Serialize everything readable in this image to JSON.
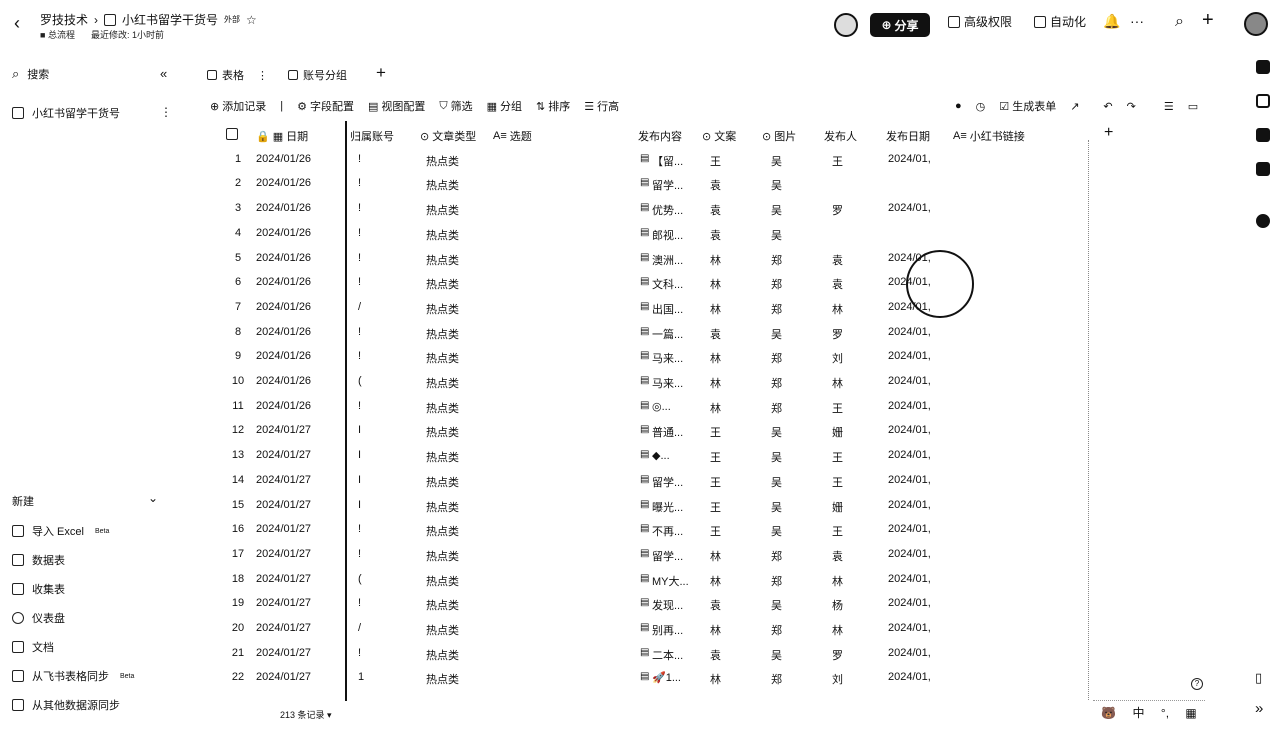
{
  "header": {
    "workspace": "罗技技术",
    "doc_title": "小红书留学干货号",
    "doc_tag": "外部",
    "folder": "总流程",
    "last_edited": "最近修改: 1小时前",
    "share_label": "分享",
    "advanced_perm": "高级权限",
    "automation": "自动化",
    "more": "···"
  },
  "sidebar": {
    "search_placeholder": "搜索",
    "table_name": "小红书留学干货号",
    "new_label": "新建",
    "items": [
      {
        "label": "导入 Excel",
        "beta": "Beta",
        "icon": "excel-icon"
      },
      {
        "label": "数据表",
        "beta": "",
        "icon": "table-icon"
      },
      {
        "label": "收集表",
        "beta": "",
        "icon": "form-icon"
      },
      {
        "label": "仪表盘",
        "beta": "",
        "icon": "dashboard-icon"
      },
      {
        "label": "文档",
        "beta": "",
        "icon": "doc-icon"
      },
      {
        "label": "从飞书表格同步",
        "beta": "Beta",
        "icon": "sync-icon"
      },
      {
        "label": "从其他数据源同步",
        "beta": "",
        "icon": "datasource-icon"
      }
    ]
  },
  "tabs": [
    {
      "label": "表格",
      "icon": "grid-icon"
    },
    {
      "label": "账号分组",
      "icon": "grid-icon"
    }
  ],
  "toolbar": {
    "add_record": "添加记录",
    "field_config": "字段配置",
    "view_config": "视图配置",
    "filter": "筛选",
    "group": "分组",
    "sort": "排序",
    "row_height": "行高",
    "generate_form": "生成表单"
  },
  "columns": [
    "日期",
    "归属账号",
    "文章类型",
    "选题",
    "发布内容",
    "文案",
    "图片",
    "发布人",
    "发布日期",
    "小红书链接"
  ],
  "rows": [
    {
      "n": "1",
      "date": "2024/01/26",
      "acct": "!",
      "type": "热点类",
      "content": "【留...",
      "copy": "王",
      "img": "吴",
      "pub": "王",
      "pdate": "2024/01,"
    },
    {
      "n": "2",
      "date": "2024/01/26",
      "acct": "!",
      "type": "热点类",
      "content": "留学...",
      "copy": "袁",
      "img": "吴",
      "pub": "",
      "pdate": ""
    },
    {
      "n": "3",
      "date": "2024/01/26",
      "acct": "!",
      "type": "热点类",
      "content": "优势...",
      "copy": "袁",
      "img": "吴",
      "pub": "罗",
      "pdate": "2024/01,"
    },
    {
      "n": "4",
      "date": "2024/01/26",
      "acct": "!",
      "type": "热点类",
      "content": "郎视...",
      "copy": "袁",
      "img": "吴",
      "pub": "",
      "pdate": ""
    },
    {
      "n": "5",
      "date": "2024/01/26",
      "acct": "!",
      "type": "热点类",
      "content": "澳洲...",
      "copy": "林",
      "img": "郑",
      "pub": "袁",
      "pdate": "2024/01,"
    },
    {
      "n": "6",
      "date": "2024/01/26",
      "acct": "!",
      "type": "热点类",
      "content": "文科...",
      "copy": "林",
      "img": "郑",
      "pub": "袁",
      "pdate": "2024/01,"
    },
    {
      "n": "7",
      "date": "2024/01/26",
      "acct": "/",
      "type": "热点类",
      "content": "出国...",
      "copy": "林",
      "img": "郑",
      "pub": "林",
      "pdate": "2024/01,"
    },
    {
      "n": "8",
      "date": "2024/01/26",
      "acct": "!",
      "type": "热点类",
      "content": "一篇...",
      "copy": "袁",
      "img": "吴",
      "pub": "罗",
      "pdate": "2024/01,"
    },
    {
      "n": "9",
      "date": "2024/01/26",
      "acct": "!",
      "type": "热点类",
      "content": "马来...",
      "copy": "林",
      "img": "郑",
      "pub": "刘",
      "pdate": "2024/01,"
    },
    {
      "n": "10",
      "date": "2024/01/26",
      "acct": "(",
      "type": "热点类",
      "content": "马来...",
      "copy": "林",
      "img": "郑",
      "pub": "林",
      "pdate": "2024/01,"
    },
    {
      "n": "11",
      "date": "2024/01/26",
      "acct": "!",
      "type": "热点类",
      "content": "◎...",
      "copy": "林",
      "img": "郑",
      "pub": "王",
      "pdate": "2024/01,"
    },
    {
      "n": "12",
      "date": "2024/01/27",
      "acct": "I",
      "type": "热点类",
      "content": "普通...",
      "copy": "王",
      "img": "吴",
      "pub": "姗",
      "pdate": "2024/01,"
    },
    {
      "n": "13",
      "date": "2024/01/27",
      "acct": "I",
      "type": "热点类",
      "content": "◆...",
      "copy": "王",
      "img": "吴",
      "pub": "王",
      "pdate": "2024/01,"
    },
    {
      "n": "14",
      "date": "2024/01/27",
      "acct": "I",
      "type": "热点类",
      "content": "留学...",
      "copy": "王",
      "img": "吴",
      "pub": "王",
      "pdate": "2024/01,"
    },
    {
      "n": "15",
      "date": "2024/01/27",
      "acct": "I",
      "type": "热点类",
      "content": "曝光...",
      "copy": "王",
      "img": "吴",
      "pub": "姗",
      "pdate": "2024/01,"
    },
    {
      "n": "16",
      "date": "2024/01/27",
      "acct": "!",
      "type": "热点类",
      "content": "不再...",
      "copy": "王",
      "img": "吴",
      "pub": "王",
      "pdate": "2024/01,"
    },
    {
      "n": "17",
      "date": "2024/01/27",
      "acct": "!",
      "type": "热点类",
      "content": "留学...",
      "copy": "林",
      "img": "郑",
      "pub": "袁",
      "pdate": "2024/01,"
    },
    {
      "n": "18",
      "date": "2024/01/27",
      "acct": "(",
      "type": "热点类",
      "content": "MY大...",
      "copy": "林",
      "img": "郑",
      "pub": "林",
      "pdate": "2024/01,"
    },
    {
      "n": "19",
      "date": "2024/01/27",
      "acct": "!",
      "type": "热点类",
      "content": "发现...",
      "copy": "袁",
      "img": "吴",
      "pub": "杨",
      "pdate": "2024/01,"
    },
    {
      "n": "20",
      "date": "2024/01/27",
      "acct": "/",
      "type": "热点类",
      "content": "别再...",
      "copy": "林",
      "img": "郑",
      "pub": "林",
      "pdate": "2024/01,"
    },
    {
      "n": "21",
      "date": "2024/01/27",
      "acct": "!",
      "type": "热点类",
      "content": "二本...",
      "copy": "袁",
      "img": "吴",
      "pub": "罗",
      "pdate": "2024/01,"
    },
    {
      "n": "22",
      "date": "2024/01/27",
      "acct": "1",
      "type": "热点类",
      "content": "🚀1...",
      "copy": "林",
      "img": "郑",
      "pub": "刘",
      "pdate": "2024/01,"
    }
  ],
  "footer": {
    "record_count": "213 条记录"
  },
  "ime": {
    "lang": "中"
  }
}
